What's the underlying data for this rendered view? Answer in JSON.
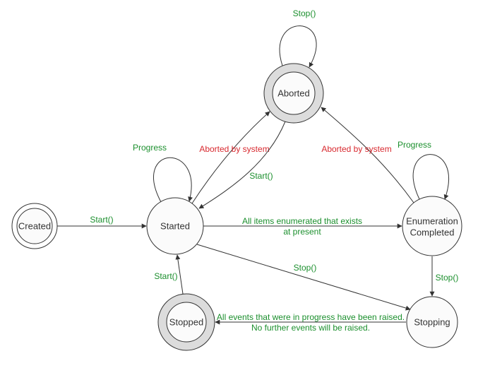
{
  "chart_data": {
    "type": "state-machine",
    "title": "",
    "states": [
      {
        "id": "created",
        "label": "Created",
        "style": "initial"
      },
      {
        "id": "started",
        "label": "Started",
        "style": "normal"
      },
      {
        "id": "aborted",
        "label": "Aborted",
        "style": "final"
      },
      {
        "id": "enumeration_completed",
        "label": "Enumeration Completed",
        "style": "normal"
      },
      {
        "id": "stopping",
        "label": "Stopping",
        "style": "normal"
      },
      {
        "id": "stopped",
        "label": "Stopped",
        "style": "final"
      }
    ],
    "transitions": [
      {
        "from": "created",
        "to": "started",
        "label": "start",
        "kind": "user"
      },
      {
        "from": "started",
        "to": "started",
        "label": "progress",
        "kind": "user"
      },
      {
        "from": "started",
        "to": "aborted",
        "label": "aborted_system",
        "kind": "system"
      },
      {
        "from": "aborted",
        "to": "aborted",
        "label": "stop_self",
        "kind": "user"
      },
      {
        "from": "aborted",
        "to": "started",
        "label": "restart",
        "kind": "user"
      },
      {
        "from": "started",
        "to": "enumeration_completed",
        "label": "all_items_line1",
        "label2": "all_items_line2",
        "kind": "user"
      },
      {
        "from": "enumeration_completed",
        "to": "enumeration_completed",
        "label": "progress2",
        "kind": "user"
      },
      {
        "from": "enumeration_completed",
        "to": "aborted",
        "label": "aborted_system2",
        "kind": "system"
      },
      {
        "from": "enumeration_completed",
        "to": "stopping",
        "label": "stop1",
        "kind": "user"
      },
      {
        "from": "started",
        "to": "stopping",
        "label": "stop2",
        "kind": "user"
      },
      {
        "from": "stopping",
        "to": "stopped",
        "label": "all_events_line1",
        "label2": "all_events_line2",
        "kind": "user"
      },
      {
        "from": "stopped",
        "to": "started",
        "label": "restart2",
        "kind": "user"
      }
    ]
  },
  "labels": {
    "created": "Created",
    "started": "Started",
    "aborted": "Aborted",
    "enum_l1": "Enumeration",
    "enum_l2": "Completed",
    "stopping": "Stopping",
    "stopped": "Stopped",
    "start": "Start()",
    "progress": "Progress",
    "progress2": "Progress",
    "aborted_system": "Aborted by system",
    "aborted_system2": "Aborted by system",
    "stop_self": "Stop()",
    "restart": "Start()",
    "all_items_line1": "All items enumerated that exists",
    "all_items_line2": "at present",
    "stop1": "Stop()",
    "stop2": "Stop()",
    "all_events_line1": "All events that were in progress have been raised.",
    "all_events_line2": "No further events will be raised.",
    "restart2": "Start()"
  }
}
